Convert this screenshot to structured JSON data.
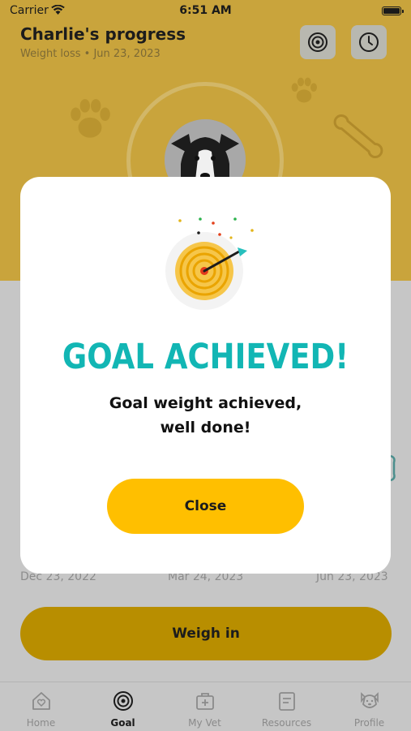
{
  "status_bar": {
    "carrier": "Carrier",
    "time": "6:51 AM"
  },
  "header": {
    "title": "Charlie's progress",
    "subtitle": "Weight loss • Jun 23, 2023"
  },
  "timeline": {
    "start_date": "Dec 23, 2022",
    "mid_date": "Mar 24, 2023",
    "end_date": "Jun 23, 2023"
  },
  "weigh_in_label": "Weigh in",
  "modal": {
    "title": "GOAL ACHIEVED!",
    "message_line1": "Goal weight achieved,",
    "message_line2": "well done!",
    "close_label": "Close"
  },
  "tabs": [
    {
      "label": "Home",
      "icon": "home-heart-icon"
    },
    {
      "label": "Goal",
      "icon": "target-icon",
      "active": true
    },
    {
      "label": "My Vet",
      "icon": "vet-kit-icon"
    },
    {
      "label": "Resources",
      "icon": "document-icon"
    },
    {
      "label": "Profile",
      "icon": "dog-face-icon"
    }
  ],
  "colors": {
    "accent_yellow": "#ffbf00",
    "goal_teal": "#12b6b4",
    "hero_dimmed": "#c9a43c"
  }
}
